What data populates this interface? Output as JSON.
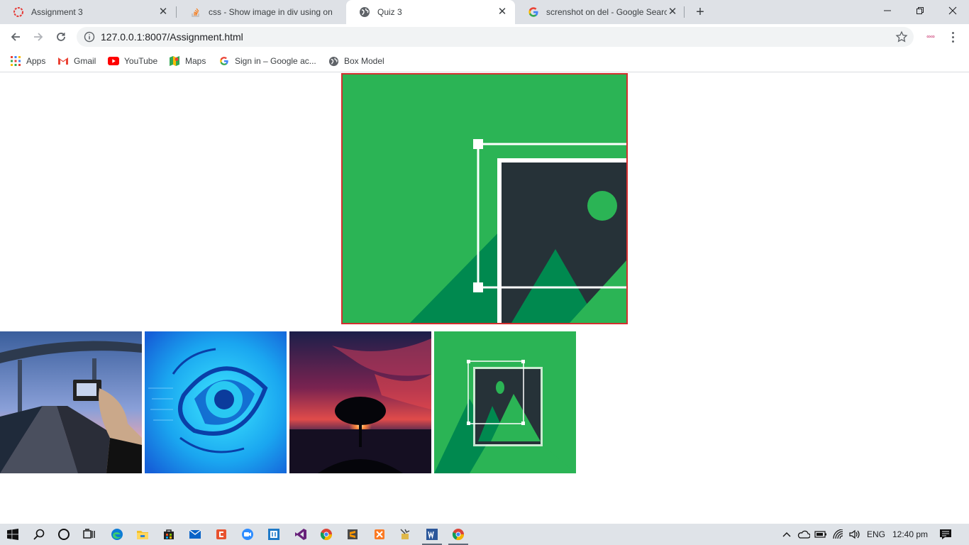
{
  "browser": {
    "tabs": [
      {
        "title": "Assignment 3",
        "icon": "red-ring-icon",
        "active": false
      },
      {
        "title": "css - Show image in div using on",
        "icon": "stackoverflow-icon",
        "active": false
      },
      {
        "title": "Quiz 3",
        "icon": "globe-icon",
        "active": true
      },
      {
        "title": "screnshot on del - Google Search",
        "icon": "google-icon",
        "active": false
      }
    ],
    "new_tab_label": "+",
    "window_controls": {
      "minimize": "—",
      "restore": "❐",
      "close": "✕"
    },
    "url": "127.0.0.1:8007/Assignment.html",
    "profile_text": "∞∞",
    "bookmarks": [
      {
        "label": "Apps",
        "icon": "apps-grid-icon"
      },
      {
        "label": "Gmail",
        "icon": "gmail-icon"
      },
      {
        "label": "YouTube",
        "icon": "youtube-icon"
      },
      {
        "label": "Maps",
        "icon": "maps-icon"
      },
      {
        "label": "Sign in – Google ac...",
        "icon": "google-icon"
      },
      {
        "label": "Box Model",
        "icon": "globe-icon"
      }
    ]
  },
  "page": {
    "main_image": {
      "name": "image-placeholder-zoomed",
      "border_color": "#d32f2f",
      "bg_color": "#2bb455"
    },
    "thumbnails": [
      {
        "name": "bridge-photo"
      },
      {
        "name": "eye-photo"
      },
      {
        "name": "tree-sunset-photo"
      },
      {
        "name": "image-placeholder-icon"
      }
    ]
  },
  "taskbar": {
    "apps": [
      "start-icon",
      "search-icon",
      "cortana-icon",
      "task-view-icon",
      "edge-icon",
      "file-explorer-icon",
      "store-icon",
      "mail-icon",
      "office-icon",
      "zoom-icon",
      "code-editor-icon",
      "visual-studio-icon",
      "chrome-icon",
      "sublime-icon",
      "xampp-icon",
      "tools-icon",
      "word-icon",
      "chrome-active-icon"
    ],
    "language": "ENG",
    "time": "12:40 pm"
  },
  "colors": {
    "accent_green": "#2bb455",
    "dark_green": "#00894f",
    "charcoal": "#263238",
    "border_red": "#d32f2f"
  }
}
